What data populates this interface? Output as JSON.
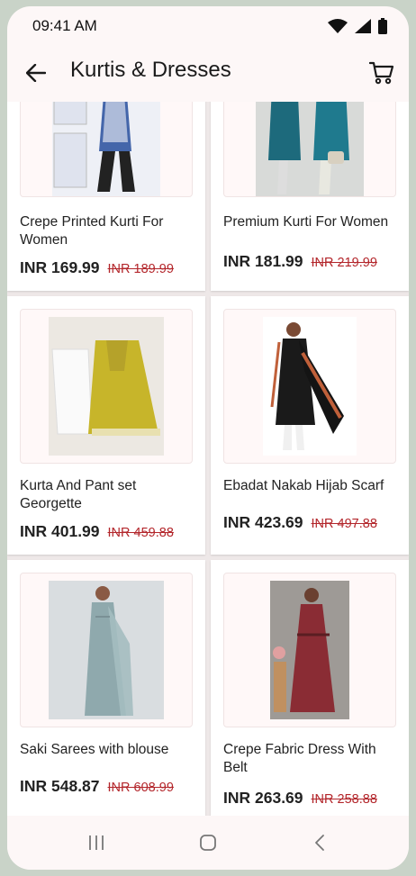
{
  "status_bar": {
    "time": "09:41 AM"
  },
  "app_bar": {
    "title": "Kurtis & Dresses"
  },
  "colors": {
    "accent_red": "#b3262b",
    "background": "#fdf7f7"
  },
  "products": [
    {
      "name": "Crepe Printed Kurti For Women",
      "price": "INR 169.99",
      "old_price": "INR 189.99",
      "image_code": "s-69584319"
    },
    {
      "name": "Premium Kurti For Women",
      "price": "INR 181.99",
      "old_price": "INR 219.99",
      "image_code": "s-69584322"
    },
    {
      "name": "Kurta And Pant set Georgette",
      "price": "INR 401.99",
      "old_price": "INR 459.88",
      "image_code": "s-96458886"
    },
    {
      "name": "Ebadat Nakab Hijab Scarf",
      "price": "INR 423.69",
      "old_price": "INR 497.88",
      "image_code": "s-54211029"
    },
    {
      "name": "Saki Sarees with blouse",
      "price": "INR 548.87",
      "old_price": "INR 608.99",
      "image_code": "s-32709528"
    },
    {
      "name": "Crepe Fabric Dress With Belt",
      "price": "INR 263.69",
      "old_price": "INR 258.88",
      "image_code": "s-30593028"
    }
  ],
  "icons": {
    "back": "arrow-left-icon",
    "cart": "cart-icon",
    "nav_recents": "recents-icon",
    "nav_home": "home-icon",
    "nav_back": "nav-back-icon"
  }
}
